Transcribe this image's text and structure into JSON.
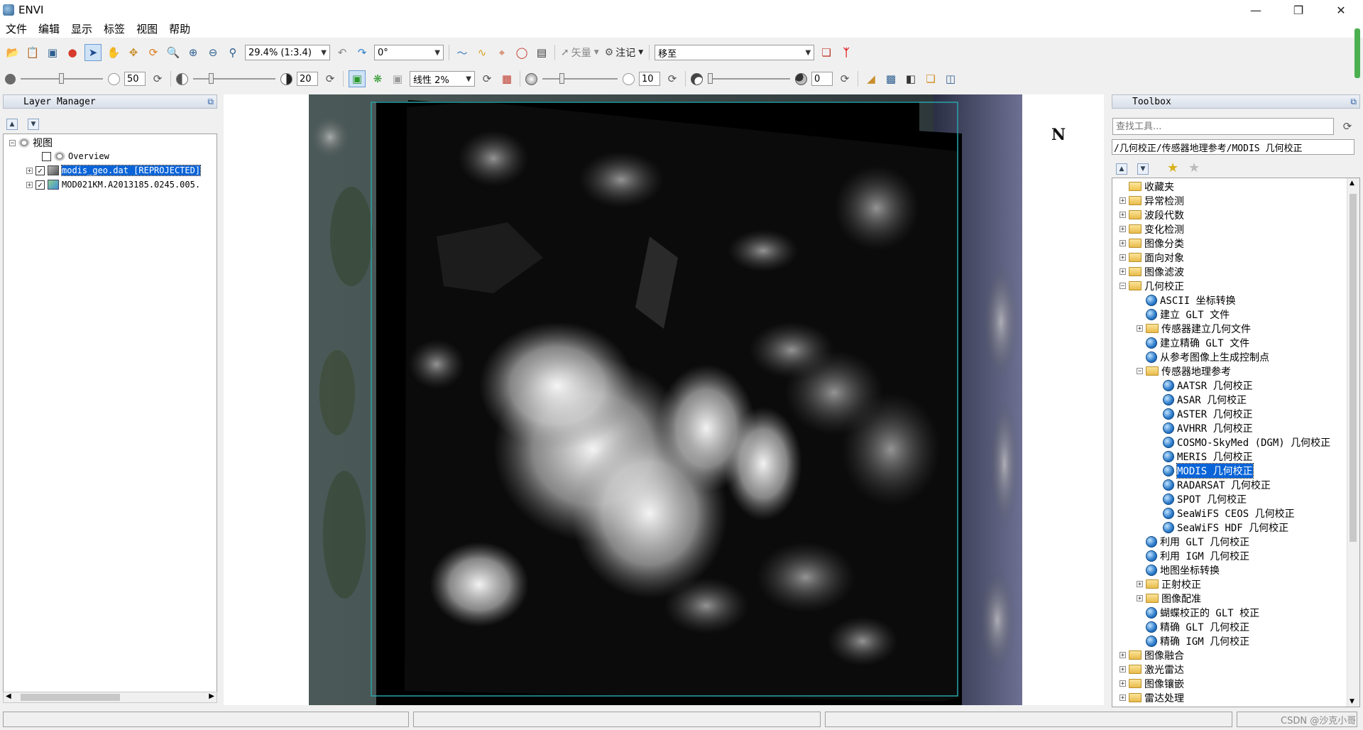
{
  "window": {
    "title": "ENVI"
  },
  "menu": [
    "文件",
    "编辑",
    "显示",
    "标签",
    "视图",
    "帮助"
  ],
  "toolbar1": {
    "zoom_value": "29.4% (1:3.4)",
    "rotation_value": "0°",
    "vector_label": "矢量",
    "annotation_label": "注记",
    "goto_value": "移至"
  },
  "toolbar2": {
    "brightness_value": "50",
    "contrast_value": "20",
    "stretch_value": "线性 2%",
    "sharpen_value": "10",
    "transparency_value": "0"
  },
  "layer_manager": {
    "title": "Layer Manager",
    "root": "视图",
    "overview": "Overview",
    "layers": [
      {
        "name": "modis_geo.dat [REPROJECTED]",
        "checked": true,
        "selected": true
      },
      {
        "name": "MOD021KM.A2013185.0245.005.",
        "checked": true,
        "selected": false
      }
    ]
  },
  "view": {
    "north_label": "N"
  },
  "toolbox": {
    "title": "Toolbox",
    "search_placeholder": "查找工具...",
    "path": "/几何校正/传感器地理参考/MODIS 几何校正",
    "items": [
      {
        "label": "收藏夹",
        "level": 0,
        "type": "fav",
        "expander": ""
      },
      {
        "label": "异常检测",
        "level": 0,
        "type": "folder",
        "expander": "+"
      },
      {
        "label": "波段代数",
        "level": 0,
        "type": "folder",
        "expander": "+"
      },
      {
        "label": "变化检测",
        "level": 0,
        "type": "folder",
        "expander": "+"
      },
      {
        "label": "图像分类",
        "level": 0,
        "type": "folder",
        "expander": "+"
      },
      {
        "label": "面向对象",
        "level": 0,
        "type": "folder",
        "expander": "+"
      },
      {
        "label": "图像滤波",
        "level": 0,
        "type": "folder",
        "expander": "+"
      },
      {
        "label": "几何校正",
        "level": 0,
        "type": "folder",
        "expander": "−"
      },
      {
        "label": "ASCII 坐标转换",
        "level": 1,
        "type": "tool",
        "expander": ""
      },
      {
        "label": "建立 GLT 文件",
        "level": 1,
        "type": "tool",
        "expander": ""
      },
      {
        "label": "传感器建立几何文件",
        "level": 1,
        "type": "folder",
        "expander": "+"
      },
      {
        "label": "建立精确 GLT 文件",
        "level": 1,
        "type": "tool",
        "expander": ""
      },
      {
        "label": "从参考图像上生成控制点",
        "level": 1,
        "type": "tool",
        "expander": ""
      },
      {
        "label": "传感器地理参考",
        "level": 1,
        "type": "folder",
        "expander": "−"
      },
      {
        "label": "AATSR 几何校正",
        "level": 2,
        "type": "tool",
        "expander": ""
      },
      {
        "label": "ASAR 几何校正",
        "level": 2,
        "type": "tool",
        "expander": ""
      },
      {
        "label": "ASTER 几何校正",
        "level": 2,
        "type": "tool",
        "expander": ""
      },
      {
        "label": "AVHRR 几何校正",
        "level": 2,
        "type": "tool",
        "expander": ""
      },
      {
        "label": "COSMO-SkyMed (DGM) 几何校正",
        "level": 2,
        "type": "tool",
        "expander": ""
      },
      {
        "label": "MERIS 几何校正",
        "level": 2,
        "type": "tool",
        "expander": ""
      },
      {
        "label": "MODIS 几何校正",
        "level": 2,
        "type": "tool",
        "expander": "",
        "selected": true
      },
      {
        "label": "RADARSAT 几何校正",
        "level": 2,
        "type": "tool",
        "expander": ""
      },
      {
        "label": "SPOT 几何校正",
        "level": 2,
        "type": "tool",
        "expander": ""
      },
      {
        "label": "SeaWiFS CEOS 几何校正",
        "level": 2,
        "type": "tool",
        "expander": ""
      },
      {
        "label": "SeaWiFS HDF 几何校正",
        "level": 2,
        "type": "tool",
        "expander": ""
      },
      {
        "label": "利用 GLT 几何校正",
        "level": 1,
        "type": "tool",
        "expander": ""
      },
      {
        "label": "利用 IGM 几何校正",
        "level": 1,
        "type": "tool",
        "expander": ""
      },
      {
        "label": "地图坐标转换",
        "level": 1,
        "type": "tool",
        "expander": ""
      },
      {
        "label": "正射校正",
        "level": 1,
        "type": "folder",
        "expander": "+"
      },
      {
        "label": "图像配准",
        "level": 1,
        "type": "folder",
        "expander": "+"
      },
      {
        "label": "蝴蝶校正的 GLT 校正",
        "level": 1,
        "type": "tool",
        "expander": ""
      },
      {
        "label": "精确 GLT 几何校正",
        "level": 1,
        "type": "tool",
        "expander": ""
      },
      {
        "label": "精确 IGM 几何校正",
        "level": 1,
        "type": "tool",
        "expander": ""
      },
      {
        "label": "图像融合",
        "level": 0,
        "type": "folder",
        "expander": "+"
      },
      {
        "label": "激光雷达",
        "level": 0,
        "type": "folder",
        "expander": "+"
      },
      {
        "label": "图像镶嵌",
        "level": 0,
        "type": "folder",
        "expander": "+"
      },
      {
        "label": "雷达处理",
        "level": 0,
        "type": "folder",
        "expander": "+"
      }
    ]
  },
  "watermark": "CSDN @沙克小哥"
}
